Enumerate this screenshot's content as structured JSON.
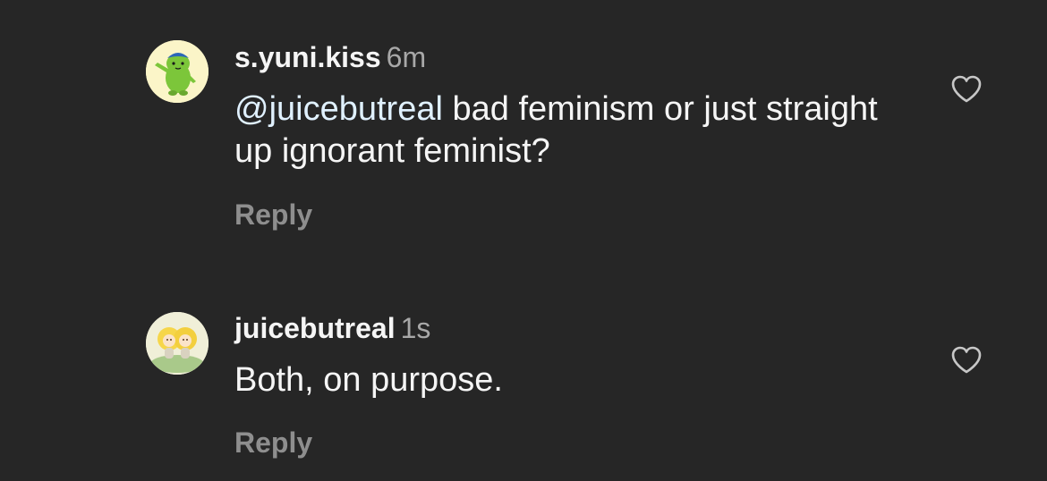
{
  "colors": {
    "background": "#262626",
    "text": "#f5f5f5",
    "secondary_text": "#a8a8a8",
    "reply_text": "#8e8e8e",
    "mention": "#e0f1ff",
    "icon_stroke": "#c7c7c7"
  },
  "comments": [
    {
      "username": "s.yuni.kiss",
      "timestamp": "6m",
      "mention": "@juicebutreal",
      "text": " bad feminism or just straight up ignorant feminist?",
      "reply_label": "Reply",
      "avatar_icon": "green-cartoon-creature-avatar",
      "like_icon": "heart-outline-icon"
    },
    {
      "username": "juicebutreal",
      "timestamp": "1s",
      "mention": "",
      "text": "Both, on purpose.",
      "reply_label": "Reply",
      "avatar_icon": "yellow-flower-babies-avatar",
      "like_icon": "heart-outline-icon"
    }
  ]
}
